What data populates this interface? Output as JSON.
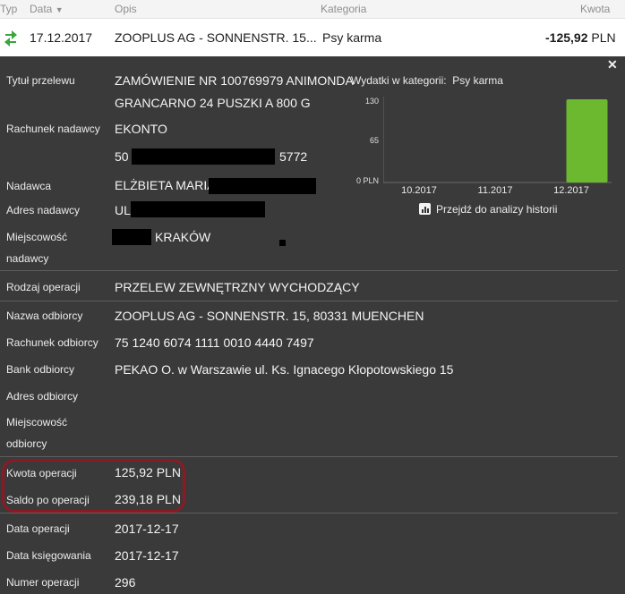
{
  "header": {
    "type": "Typ",
    "date": "Data",
    "description": "Opis",
    "category": "Kategoria",
    "amount": "Kwota"
  },
  "transaction": {
    "date": "17.12.2017",
    "description": "ZOOPLUS AG - SONNENSTR. 15...",
    "category": "Psy karma",
    "amount": "-125,92",
    "currency": "PLN"
  },
  "details": {
    "close_icon": "close-icon",
    "title_label": "Tytuł przelewu",
    "title_line1": "ZAMÓWIENIE NR 100769979 ANIMONDA",
    "title_line2": "GRANCARNO 24 PUSZKI A 800 G",
    "sender_account_label": "Rachunek nadawcy",
    "sender_account_name": "EKONTO",
    "sender_account_prefix": "50",
    "sender_account_suffix": "5772",
    "sender_label": "Nadawca",
    "sender_value": "ELŻBIETA MARIA M",
    "sender_address_label": "Adres nadawcy",
    "sender_address_value": "UL.",
    "sender_city_label_1": "Miejscowość",
    "sender_city_label_2": "nadawcy",
    "sender_city_value": "KRAKÓW",
    "operation_type_label": "Rodzaj operacji",
    "operation_type_value": "PRZELEW ZEWNĘTRZNY WYCHODZĄCY",
    "recipient_name_label": "Nazwa odbiorcy",
    "recipient_name_value": "ZOOPLUS AG - SONNENSTR. 15, 80331 MUENCHEN",
    "recipient_account_label": "Rachunek odbiorcy",
    "recipient_account_value": "75 1240 6074 1111 0010 4440 7497",
    "recipient_bank_label": "Bank odbiorcy",
    "recipient_bank_value": "PEKAO O. w Warszawie ul. Ks. Ignacego Kłopotowskiego 15",
    "recipient_address_label": "Adres odbiorcy",
    "recipient_city_label_1": "Miejscowość",
    "recipient_city_label_2": "odbiorcy",
    "operation_amount_label": "Kwota operacji",
    "operation_amount_value": "125,92 PLN",
    "balance_label": "Saldo po operacji",
    "balance_value": "239,18 PLN",
    "operation_date_label": "Data operacji",
    "operation_date_value": "2017-12-17",
    "booking_date_label": "Data księgowania",
    "booking_date_value": "2017-12-17",
    "operation_number_label": "Numer operacji",
    "operation_number_value": "296"
  },
  "chart_label": "Wydatki w kategorii:",
  "chart_category": "Psy karma",
  "history_link": "Przejdź do analizy historii",
  "chart_data": {
    "type": "bar",
    "categories": [
      "10.2017",
      "11.2017",
      "12.2017"
    ],
    "values": [
      0,
      0,
      126
    ],
    "ylim": [
      0,
      130
    ],
    "yticks": [
      "130",
      "65",
      "0 PLN"
    ],
    "bar_color": "#6cb82e",
    "highlight_color": "#8b1a25"
  }
}
